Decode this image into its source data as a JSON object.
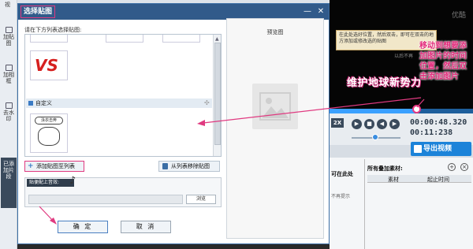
{
  "bg": {
    "tab_top": "视",
    "sidebar": [
      {
        "label": "加贴图"
      },
      {
        "label": "加相框"
      },
      {
        "label": "去水印"
      },
      {
        "label": "已添加片段"
      }
    ],
    "video": {
      "tip": "在此处选好位置，然后双击，即可在双击的地方添加或修改选的贴图",
      "tip_check": "以后不再",
      "logo": "优酷",
      "caption": "维护地球新势力"
    },
    "note": "移动到想要添加图片的时间位置，然后双击添加图片",
    "controls": {
      "speed": "2X",
      "time_current": "00:00:48.320",
      "time_total": "00:11:238",
      "export_label": "导出视频"
    },
    "bottom": {
      "left_text": "可在此处",
      "left_hint": "不再提示",
      "title": "所有叠加素材:",
      "col_material": "素材",
      "col_start": "起止时间",
      "add_icon": "+",
      "close_icon": "×"
    }
  },
  "dialog": {
    "title": "选择贴图",
    "min_icon": "—",
    "close_icon": "✕",
    "instruction": "请在下方列表选择贴图:",
    "list": {
      "vs_text": "VS",
      "section_label": "自定义",
      "meme_text": "泳衣击奔"
    },
    "add_button": "添加贴图至列表",
    "remove_button": "从列表移除贴图",
    "music_label": "贴便配上音效:",
    "browse_button": "浏览",
    "ok_button": "确 定",
    "cancel_button": "取 消",
    "preview_title": "预览图"
  },
  "colors": {
    "accent_pink": "#e03a80",
    "title_blue": "#315a8a",
    "export_blue": "#1c83d9"
  }
}
